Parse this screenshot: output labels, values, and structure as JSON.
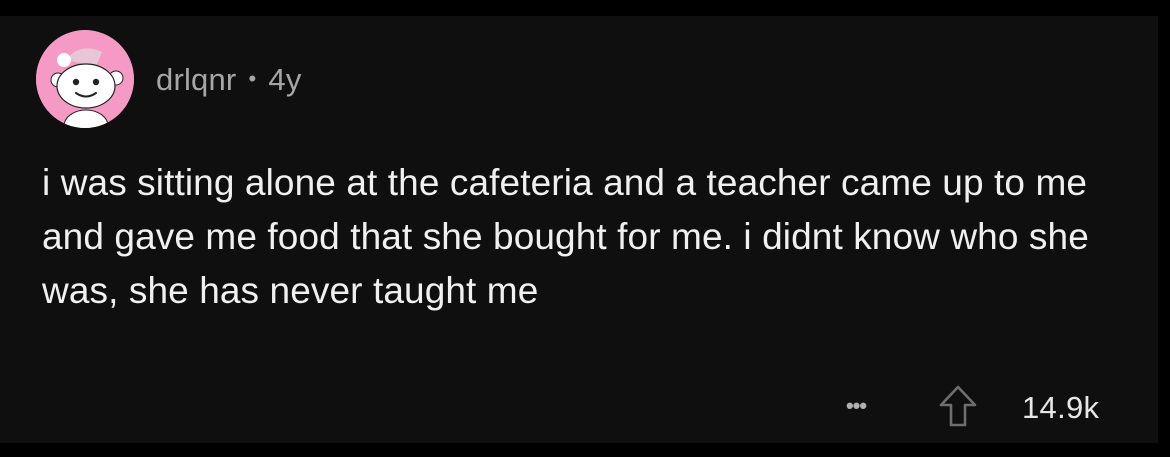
{
  "comment": {
    "username": "drlqnr",
    "separator": "•",
    "age": "4y",
    "text": "i was sitting alone at the cafeteria and a teacher came up to me and gave me food that she bought for me. i didnt know who she was, she has never taught me",
    "more_label": "•••",
    "score": "14.9k"
  },
  "icons": {
    "avatar": "snoo-avatar",
    "more": "more-options-icon",
    "upvote": "upvote-arrow-icon"
  },
  "colors": {
    "background": "#0f0f0f",
    "avatar_bg": "#f59ac4",
    "meta_text": "#a6a6a6",
    "body_text": "#f0f0f0"
  }
}
